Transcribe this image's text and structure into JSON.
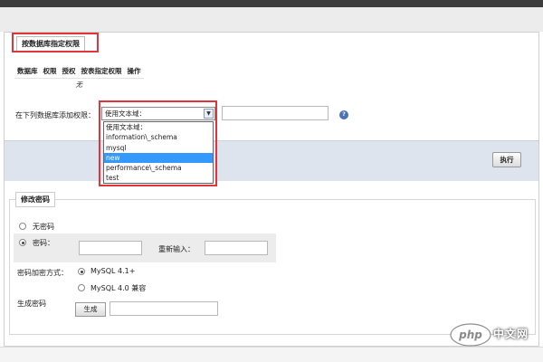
{
  "colors": {
    "highlight": "#e0353b",
    "selection": "#3399ff",
    "band": "#dde4ee"
  },
  "db_privileges": {
    "legend": "按数据库指定权限",
    "columns": [
      "数据库",
      "权限",
      "授权",
      "按表指定权限",
      "操作"
    ],
    "empty_text": "无",
    "add_label": "在下列数据库添加权限：",
    "select_value": "使用文本域：",
    "dropdown_options": [
      "使用文本域：",
      "information\\_schema",
      "mysql",
      "new",
      "performance\\_schema",
      "test"
    ],
    "selected_option": "new",
    "execute_label": "执行"
  },
  "change_password": {
    "legend": "修改密码",
    "no_password_label": "无密码",
    "password_label": "密码：",
    "reenter_label": "重新输入：",
    "hash_label": "密码加密方式：",
    "hash_options": [
      "MySQL 4.1+",
      "MySQL 4.0 兼容"
    ],
    "generate_label": "生成密码",
    "generate_button": "生成"
  },
  "watermark": {
    "logo_text": "php",
    "site_text": "中文网"
  }
}
